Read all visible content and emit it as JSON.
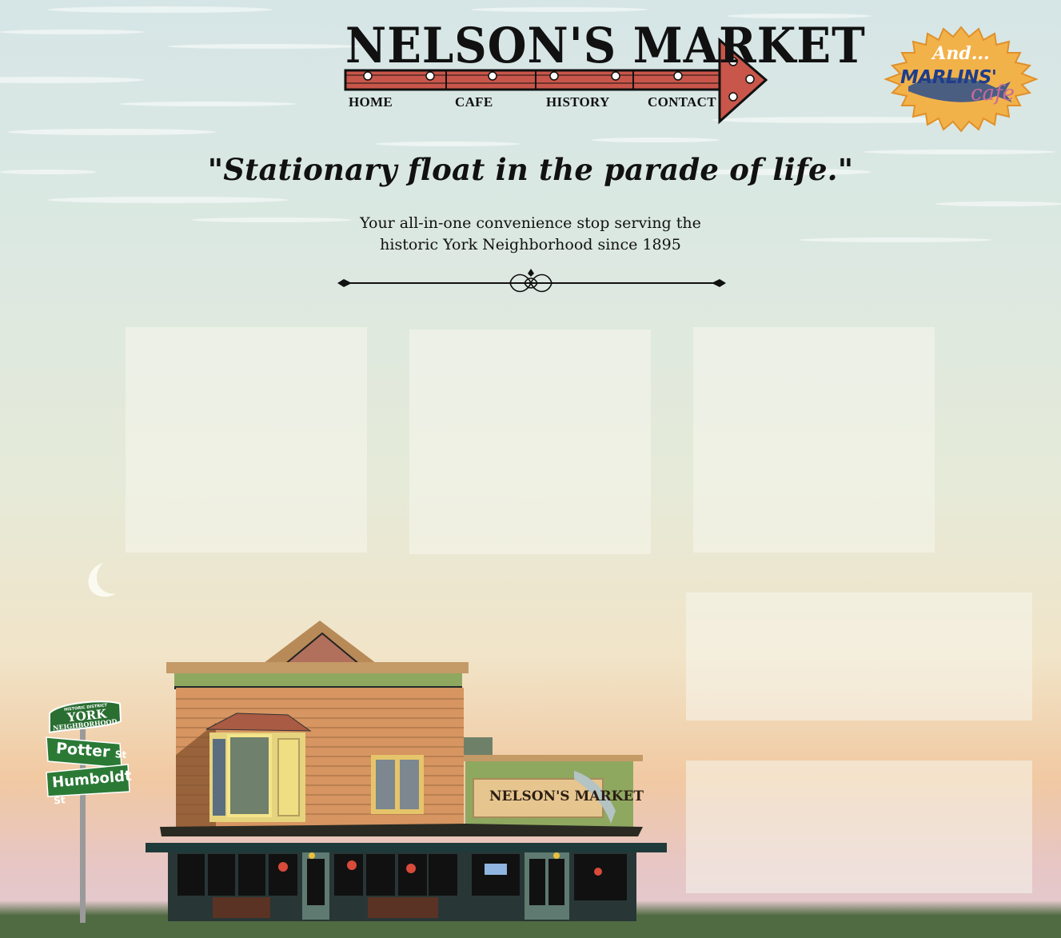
{
  "logo": {
    "title": "NELSON'S MARKET"
  },
  "nav": [
    {
      "label": "HOME"
    },
    {
      "label": "CAFE"
    },
    {
      "label": "HISTORY"
    },
    {
      "label": "CONTACT"
    }
  ],
  "badge": {
    "intro": "And...",
    "name": "MARLINS'",
    "suffix": "cafe"
  },
  "tagline": "\"Stationary float in the parade of life.\"",
  "subtitle": {
    "line1": "Your all-in-one convenience stop serving the",
    "line2": "historic York Neighborhood since 1895"
  },
  "street_sign": {
    "district_top": "HISTORIC DISTRICT",
    "district": "YORK",
    "district_bottom": "NEIGHBORHOOD",
    "street1": "Potter",
    "street1_suffix": "St",
    "street2": "Humboldt",
    "street2_suffix": "St"
  },
  "storefront": {
    "sign": "NELSON'S MARKET"
  },
  "colors": {
    "arrow_red": "#c9564a",
    "badge_orange": "#f2b24a",
    "marlin_blue": "#1f3d8a",
    "grass": "#506a42",
    "siding": "#d69561",
    "trim_green": "#8fa860"
  }
}
